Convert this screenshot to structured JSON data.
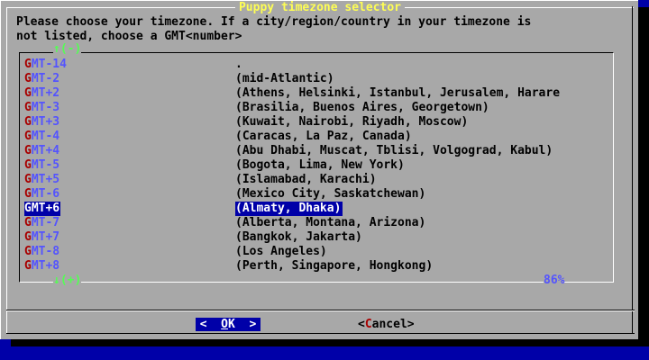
{
  "colors": {
    "background": "#0000a8",
    "dialog": "#a8a8a8",
    "title": "#fefe54",
    "tag_first": "#a80000",
    "tag_rest": "#5454fe",
    "selection": "#0000a8",
    "scroll_arrows": "#54fe54"
  },
  "dialog": {
    "title": "Puppy timezone selector",
    "prompt_line1": "Please choose your timezone. If a city/region/country in your timezone is",
    "prompt_line2": "not listed, choose a GMT<number>"
  },
  "list": {
    "scroll_up": "↑(-)",
    "scroll_down": "↓(+)",
    "scroll_percent": "86%",
    "selected_index": 10,
    "items": [
      {
        "tag_first": "G",
        "tag_rest": "MT-14",
        "desc": "."
      },
      {
        "tag_first": "G",
        "tag_rest": "MT-2",
        "desc": "(mid-Atlantic)"
      },
      {
        "tag_first": "G",
        "tag_rest": "MT+2",
        "desc": "(Athens, Helsinki, Istanbul, Jerusalem, Harare"
      },
      {
        "tag_first": "G",
        "tag_rest": "MT-3",
        "desc": "(Brasilia, Buenos Aires, Georgetown)"
      },
      {
        "tag_first": "G",
        "tag_rest": "MT+3",
        "desc": "(Kuwait, Nairobi, Riyadh, Moscow)"
      },
      {
        "tag_first": "G",
        "tag_rest": "MT-4",
        "desc": "(Caracas, La Paz, Canada)"
      },
      {
        "tag_first": "G",
        "tag_rest": "MT+4",
        "desc": "(Abu Dhabi, Muscat, Tblisi, Volgograd, Kabul)"
      },
      {
        "tag_first": "G",
        "tag_rest": "MT-5",
        "desc": "(Bogota, Lima, New York)"
      },
      {
        "tag_first": "G",
        "tag_rest": "MT+5",
        "desc": "(Islamabad, Karachi)"
      },
      {
        "tag_first": "G",
        "tag_rest": "MT-6",
        "desc": "(Mexico City, Saskatchewan)"
      },
      {
        "tag_first": "G",
        "tag_rest": "MT+6",
        "desc": "(Almaty, Dhaka)"
      },
      {
        "tag_first": "G",
        "tag_rest": "MT-7",
        "desc": "(Alberta, Montana, Arizona)"
      },
      {
        "tag_first": "G",
        "tag_rest": "MT+7",
        "desc": "(Bangkok, Jakarta)"
      },
      {
        "tag_first": "G",
        "tag_rest": "MT-8",
        "desc": "(Los Angeles)"
      },
      {
        "tag_first": "G",
        "tag_rest": "MT+8",
        "desc": "(Perth, Singapore, Hongkong)"
      }
    ]
  },
  "buttons": {
    "ok_left": "<  ",
    "ok_hot": "O",
    "ok_rest": "K",
    "ok_right": "  >",
    "cancel_left": "<",
    "cancel_hot": "C",
    "cancel_rest": "ancel",
    "cancel_right": ">"
  }
}
